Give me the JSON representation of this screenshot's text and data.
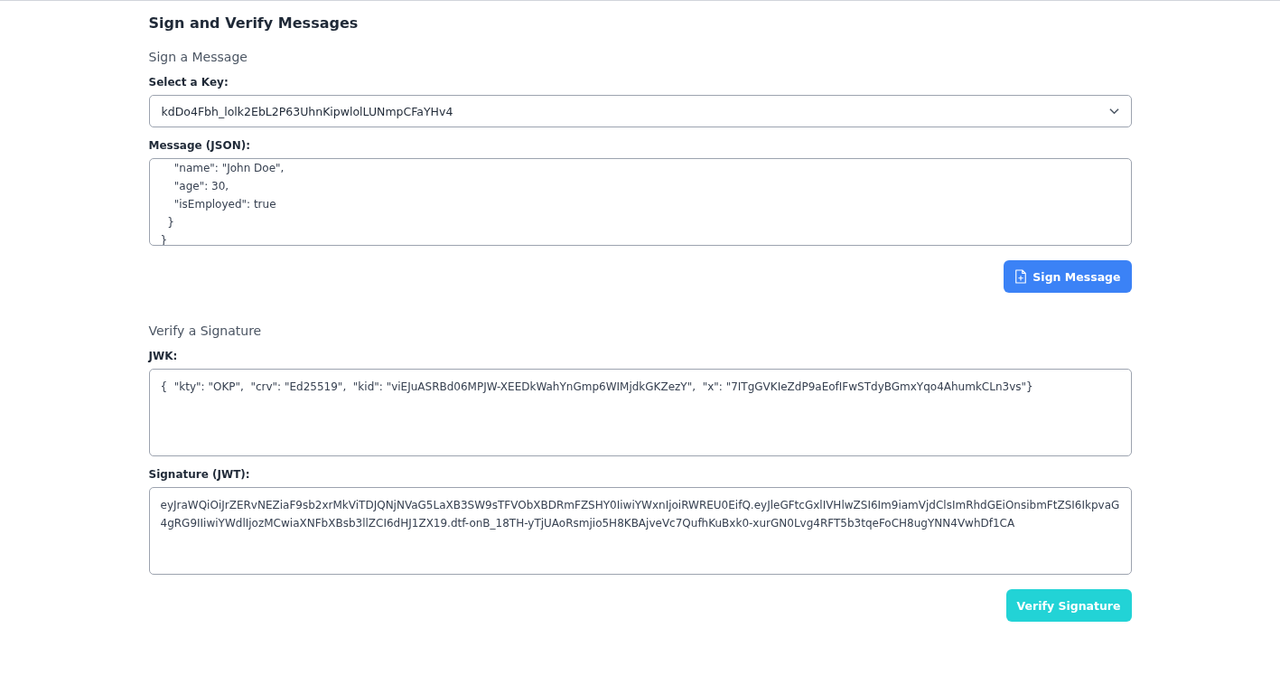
{
  "title": "Sign and Verify Messages",
  "sign_section": {
    "heading": "Sign a Message",
    "key_select": {
      "label": "Select a Key:",
      "value": "kdDo4Fbh_lolk2EbL2P63UhnKipwlolLUNmpCFaYHv4"
    },
    "message": {
      "label": "Message (JSON):",
      "lines": [
        "    \"name\": \"John Doe\",",
        "    \"age\": 30,",
        "    \"isEmployed\": true",
        "  }",
        "}"
      ]
    },
    "button": "Sign Message"
  },
  "verify_section": {
    "heading": "Verify a Signature",
    "jwk": {
      "label": "JWK:",
      "value": "{  \"kty\": \"OKP\",  \"crv\": \"Ed25519\",  \"kid\": \"viEJuASRBd06MPJW-XEEDkWahYnGmp6WIMjdkGKZezY\",  \"x\": \"7ITgGVKIeZdP9aEofIFwSTdyBGmxYqo4AhumkCLn3vs\"}"
    },
    "signature": {
      "label": "Signature (JWT):",
      "value": "eyJraWQiOiJrZERvNEZiaF9sb2xrMkViTDJQNjNVaG5LaXB3SW9sTFVObXBDRmFZSHY0IiwiYWxnIjoiRWREU0EifQ.eyJleGFtcGxlIVHlwZSI6Im9iamVjdClsImRhdGEiOnsibmFtZSI6IkpvaG4gRG9IIiwiYWdlIjozMCwiaXNFbXBsb3llZCI6dHJ1ZX19.dtf-onB_18TH-yTjUAoRsmjio5H8KBAjveVc7QufhKuBxk0-xurGN0Lvg4RFT5b3tqeFoCH8ugYNN4VwhDf1CA"
    },
    "button": "Verify Signature"
  }
}
